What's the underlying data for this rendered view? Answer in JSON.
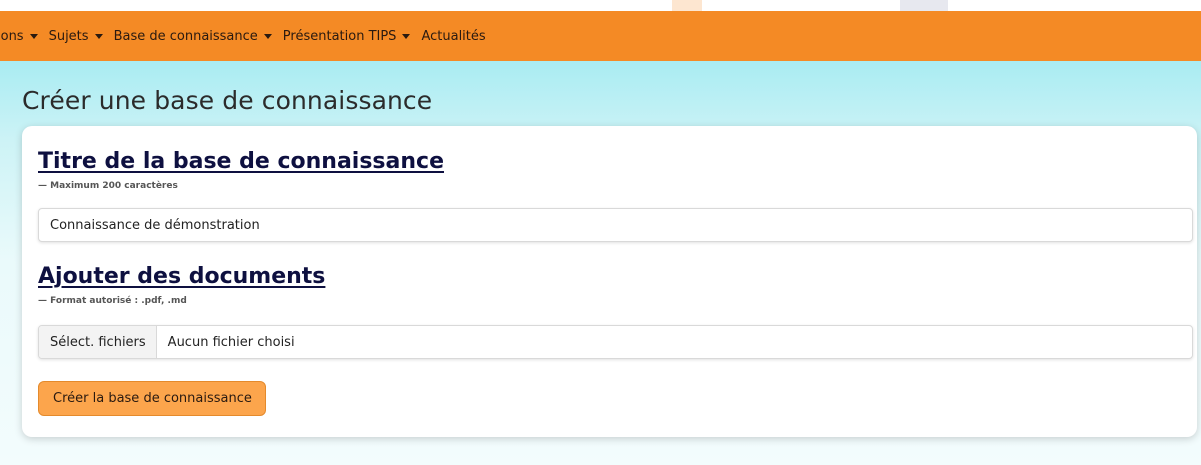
{
  "navbar": {
    "items": [
      {
        "label": "ions",
        "has_caret": true
      },
      {
        "label": "Sujets",
        "has_caret": true
      },
      {
        "label": "Base de connaissance",
        "has_caret": true
      },
      {
        "label": "Présentation TIPS",
        "has_caret": true
      },
      {
        "label": "Actualités",
        "has_caret": false
      }
    ],
    "background_color": "#f48a25"
  },
  "page": {
    "title": "Créer une base de connaissance"
  },
  "form": {
    "title_section": {
      "heading": "Titre de la base de connaissance",
      "hint": "— Maximum 200 caractères",
      "input_value": "Connaissance de démonstration"
    },
    "documents_section": {
      "heading": "Ajouter des documents",
      "hint": "— Format autorisé : .pdf, .md",
      "file_button_label": "Sélect. fichiers",
      "file_status": "Aucun fichier choisi"
    },
    "submit_label": "Créer la base de connaissance",
    "accent_color": "#fca54c"
  },
  "icons": {
    "nav_caret": "caret-down-icon"
  }
}
